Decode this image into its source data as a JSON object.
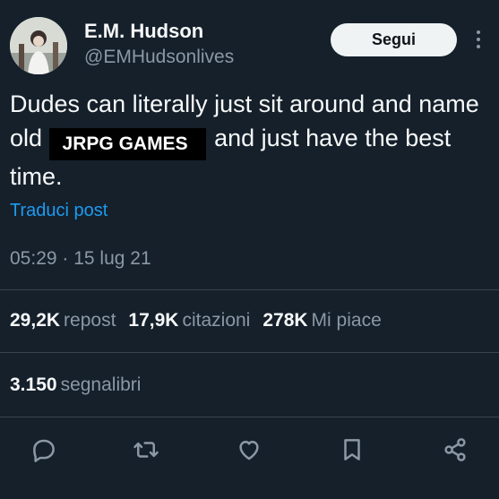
{
  "author": {
    "name": "E.M. Hudson",
    "handle": "@EMHudsonlives"
  },
  "follow_button": "Segui",
  "tweet": {
    "text_before": "Dudes can literally just sit around and name old ",
    "redacted": "JRPG GAMES",
    "text_after": " and just have the best time."
  },
  "translate_link": "Traduci post",
  "timestamp": "05:29 · 15 lug 21",
  "stats": {
    "reposts": {
      "count": "29,2K",
      "label": "repost"
    },
    "quotes": {
      "count": "17,9K",
      "label": "citazioni"
    },
    "likes": {
      "count": "278K",
      "label": "Mi piace"
    }
  },
  "bookmarks": {
    "count": "3.150",
    "label": "segnalibri"
  },
  "colors": {
    "background": "#15202b",
    "text": "#f7f9f9",
    "muted": "#8b98a5",
    "link": "#1d9bf0",
    "divider": "#38444d"
  },
  "icons": [
    "reply-icon",
    "retweet-icon",
    "like-icon",
    "bookmark-icon",
    "share-icon",
    "more-icon"
  ]
}
